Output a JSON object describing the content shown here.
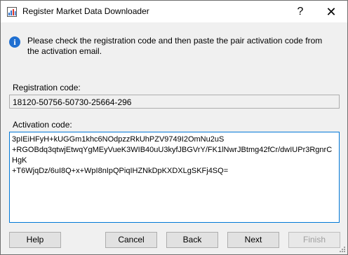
{
  "window": {
    "title": "Register Market Data Downloader",
    "help_glyph": "?",
    "close_glyph": "✕"
  },
  "info": {
    "icon": "info-icon",
    "glyph": "i",
    "message": "Please check the registration code and then paste the pair activation code from the activation email."
  },
  "registration": {
    "label": "Registration code:",
    "value": "18120-50756-50730-25664-296"
  },
  "activation": {
    "label": "Activation code:",
    "value": "3pIEiHFyH+kUGGm1khc6NOdpzzRkUhPZV9749I2OmNu2uS\n+RGOBdq3qtwjEtwqYgMEyVueK3WIB40uU3kyfJBGVrY/FK1lNwrJBtmg42fCr/dwIUPr3RgnrCHgK\n+T6WjqDz/6uI8Q+x+WpI8nIpQPiqIHZNkDpKXDXLgSKFj4SQ="
  },
  "buttons": {
    "help": "Help",
    "cancel": "Cancel",
    "back": "Back",
    "next": "Next",
    "finish": "Finish"
  },
  "colors": {
    "accent": "#0078d7",
    "info_icon": "#1f6fd1",
    "dialog_bg": "#f0f0f0"
  }
}
